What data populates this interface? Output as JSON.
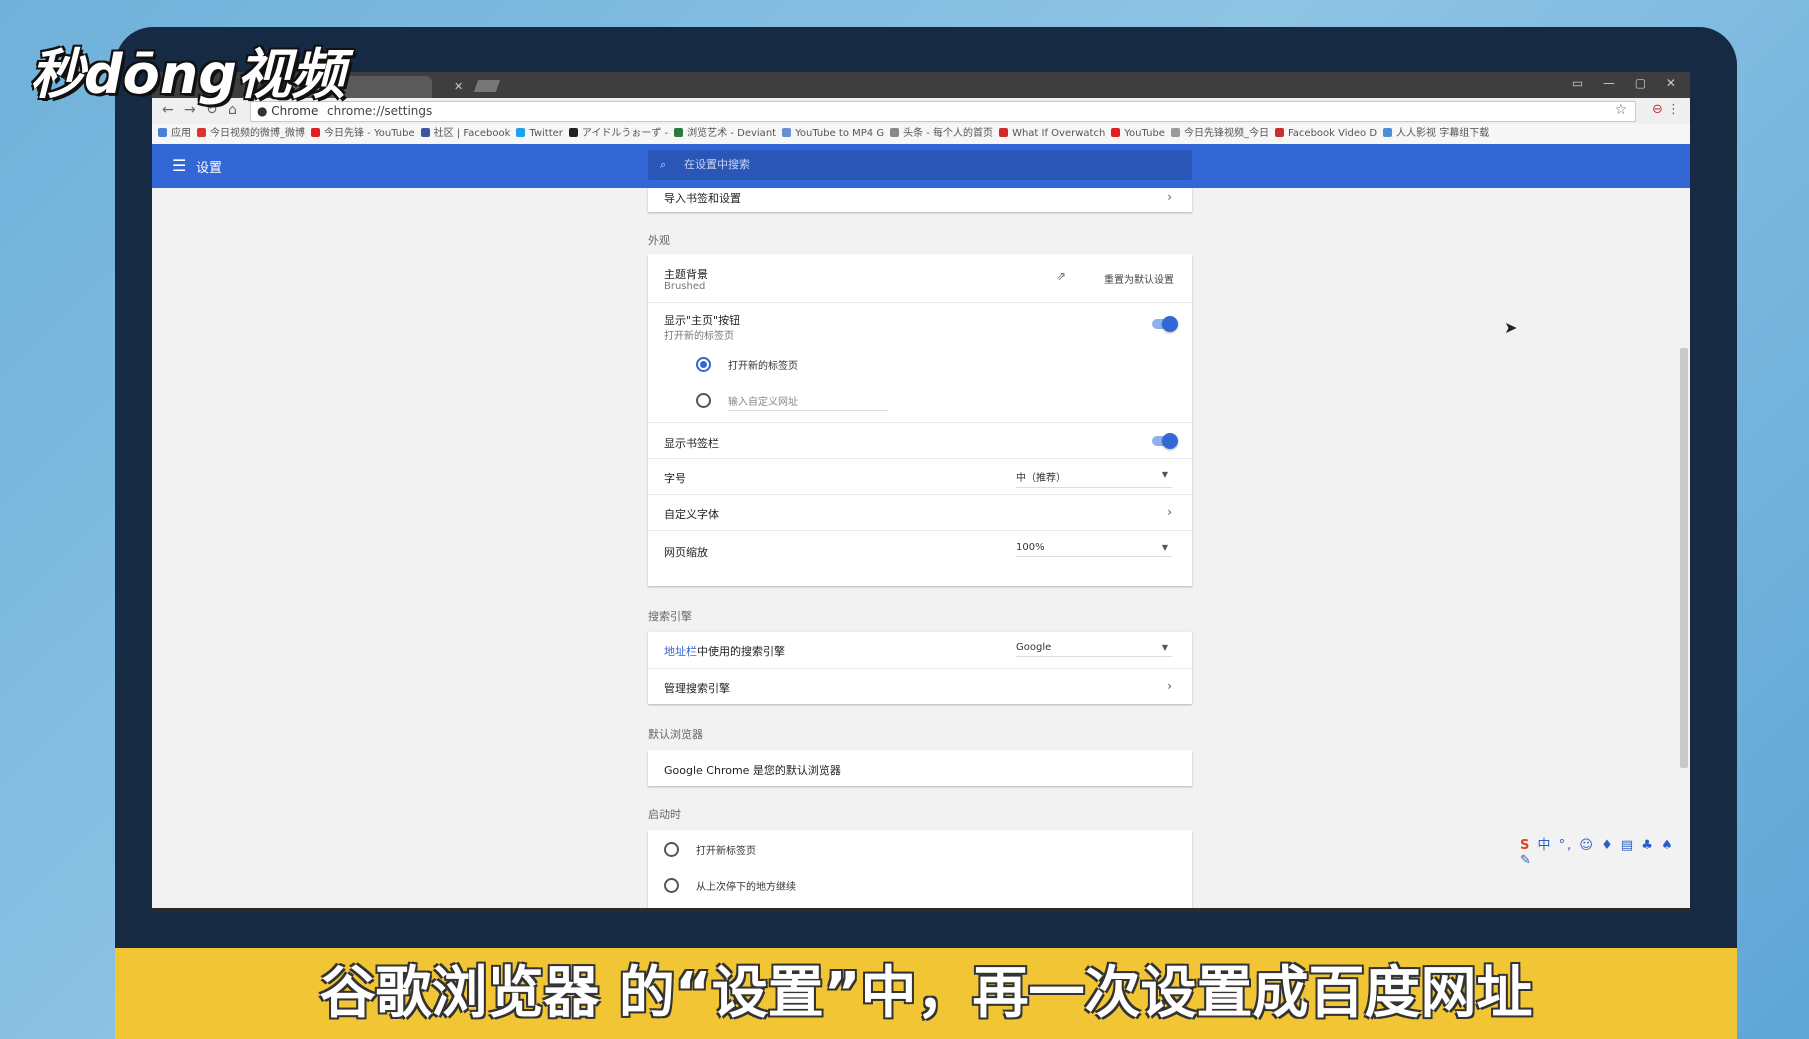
{
  "logo": "秒dōng视频",
  "browser": {
    "tabs": [
      {
        "label": "设置"
      }
    ],
    "nav_icons": [
      "back-icon",
      "forward-icon",
      "reload-icon",
      "home-icon"
    ],
    "url_chip": "Chrome",
    "url": "chrome://settings",
    "bookmarks": [
      {
        "label": "应用",
        "color": "#4a80d8"
      },
      {
        "label": "今日视频的微博_微博",
        "color": "#d9352a"
      },
      {
        "label": "今日先锋 - YouTube",
        "color": "#e02020"
      },
      {
        "label": "社区 | Facebook",
        "color": "#3b5998"
      },
      {
        "label": "Twitter",
        "color": "#1da1f2"
      },
      {
        "label": "アイドルうぉーず -",
        "color": "#222222"
      },
      {
        "label": "浏览艺术 - Deviant",
        "color": "#2b7a3d"
      },
      {
        "label": "YouTube to MP4 G",
        "color": "#6a8fd0"
      },
      {
        "label": "头条 - 每个人的首页",
        "color": "#888888"
      },
      {
        "label": "What If Overwatch",
        "color": "#d02a2a"
      },
      {
        "label": "YouTube",
        "color": "#e02020"
      },
      {
        "label": "今日先锋视频_今日",
        "color": "#999999"
      },
      {
        "label": "Facebook Video D",
        "color": "#c9302c"
      },
      {
        "label": "人人影视 字幕组下载",
        "color": "#4a90d8"
      }
    ]
  },
  "appbar": {
    "title": "设置",
    "search_placeholder": "在设置中搜索",
    "color": "#3367d6"
  },
  "settings": {
    "import_row": "导入书签和设置",
    "appearance": {
      "section": "外观",
      "theme_label": "主题背景",
      "theme_value": "Brushed",
      "theme_reset": "重置为默认设置",
      "home_label": "显示\"主页\"按钮",
      "home_sub": "打开新的标签页",
      "home_option_1": "打开新的标签页",
      "home_option_2": "输入自定义网址",
      "bookmarks_bar": "显示书签栏",
      "font_size_label": "字号",
      "font_size_value": "中（推荐）",
      "custom_fonts": "自定义字体",
      "zoom_label": "网页缩放",
      "zoom_value": "100%"
    },
    "search": {
      "section": "搜索引擎",
      "engine_label_link": "地址栏",
      "engine_label_rest": "中使用的搜索引擎",
      "engine_value": "Google",
      "manage": "管理搜索引擎"
    },
    "default_browser": {
      "section": "默认浏览器",
      "text": "Google Chrome 是您的默认浏览器"
    },
    "startup": {
      "section": "启动时",
      "option_1": "打开新标签页",
      "option_2": "从上次停下的地方继续"
    }
  },
  "ime_bar": "中 °, ☺ ♦ ▤ ♣ ♠ ✎",
  "subtitle": "谷歌浏览器 的“设置”中，再一次设置成百度网址"
}
